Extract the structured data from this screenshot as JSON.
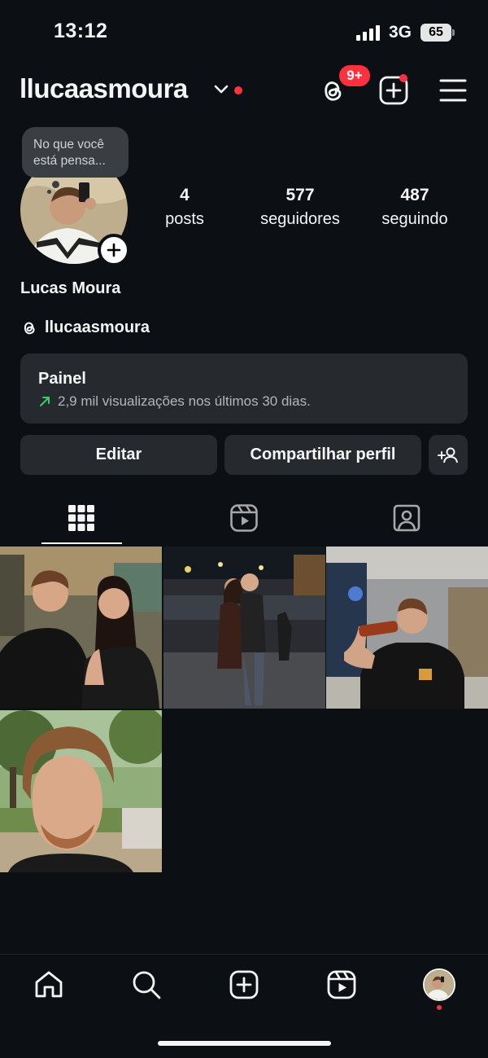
{
  "status_bar": {
    "time": "13:12",
    "network": "3G",
    "battery": "65"
  },
  "header": {
    "username": "llucaasmoura",
    "threads_badge": "9+"
  },
  "profile": {
    "note_line1": "No que você",
    "note_line2": "está pensa...",
    "stats": [
      {
        "value": "4",
        "label": "posts"
      },
      {
        "value": "577",
        "label": "seguidores"
      },
      {
        "value": "487",
        "label": "seguindo"
      }
    ],
    "full_name": "Lucas Moura",
    "threads_handle": "llucaasmoura"
  },
  "dashboard": {
    "title": "Painel",
    "subtitle": "2,9 mil visualizações nos últimos 30 dias."
  },
  "actions": {
    "edit": "Editar",
    "share": "Compartilhar perfil"
  },
  "tabs": [
    "grid-icon",
    "reels-icon",
    "tagged-icon"
  ],
  "posts": [
    "couple-photo",
    "night-street-photo",
    "drinking-photo",
    "selfie-photo"
  ],
  "nav": [
    "home-icon",
    "search-icon",
    "create-icon",
    "reels-icon",
    "profile-avatar"
  ],
  "colors": {
    "background": "#0c1014",
    "card": "#26292e",
    "accent_red": "#ff3040",
    "trend_green": "#2fd06a"
  }
}
